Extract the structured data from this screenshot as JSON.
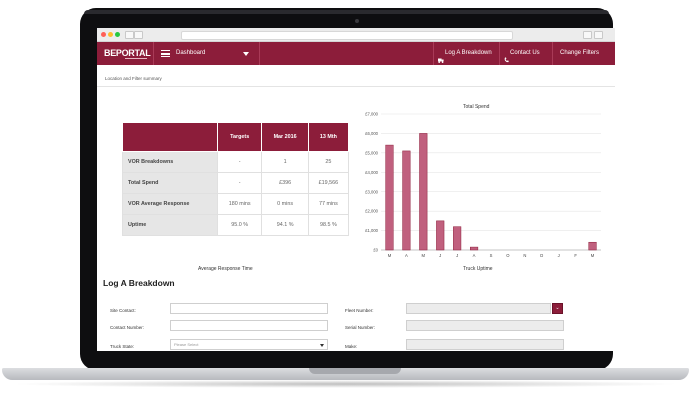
{
  "browser": {
    "window_controls": [
      "close",
      "minimize",
      "maximize"
    ],
    "traffic_colors": [
      "#ff5f57",
      "#febc2e",
      "#28c840"
    ]
  },
  "nav": {
    "logo": "BEPORTAL",
    "dashboard_label": "Dashboard",
    "log_breakdown_label": "Log A Breakdown",
    "contact_label": "Contact Us",
    "change_filters_label": "Change Filters",
    "accent_color": "#8c1d3a"
  },
  "breadcrumb": "Location and Filter summary",
  "kpi_table": {
    "headers": [
      "",
      "Targets",
      "Mar 2016",
      "13 Mth"
    ],
    "rows": [
      {
        "label": "VOR Breakdowns",
        "target": "-",
        "month": "1",
        "year": "25"
      },
      {
        "label": "Total Spend",
        "target": "-",
        "month": "£396",
        "year": "£19,566"
      },
      {
        "label": "VOR Average Response",
        "target": "180 mins",
        "month": "0 mins",
        "year": "77 mins"
      },
      {
        "label": "Uptime",
        "target": "95.0 %",
        "month": "94.1 %",
        "year": "98.5 %"
      }
    ]
  },
  "avg_response_title": "Average Response Time",
  "truck_uptime_title": "Truck Uptime",
  "chart_data": {
    "type": "bar",
    "title": "Total Spend",
    "categories": [
      "M",
      "A",
      "M",
      "J",
      "J",
      "A",
      "S",
      "O",
      "N",
      "D",
      "J",
      "F",
      "M"
    ],
    "values": [
      5400,
      5100,
      6000,
      1500,
      1200,
      150,
      0,
      0,
      0,
      0,
      0,
      0,
      400
    ],
    "ylim": [
      0,
      7000
    ],
    "yticks": [
      "£0",
      "£1,000",
      "£2,000",
      "£3,000",
      "£4,000",
      "£5,000",
      "£6,000",
      "£7,000"
    ],
    "xlabel": "",
    "ylabel": "",
    "grid": true,
    "bar_color": "#c0607e"
  },
  "form": {
    "title": "Log A Breakdown",
    "site_contact_label": "Site Contact:",
    "contact_number_label": "Contact Number:",
    "truck_state_label": "Truck State:",
    "truck_state_placeholder": "Please Select",
    "fleet_number_label": "Fleet Number:",
    "serial_number_label": "Serial Number:",
    "make_label": "Make:",
    "dropdown_glyph": "⌄"
  }
}
